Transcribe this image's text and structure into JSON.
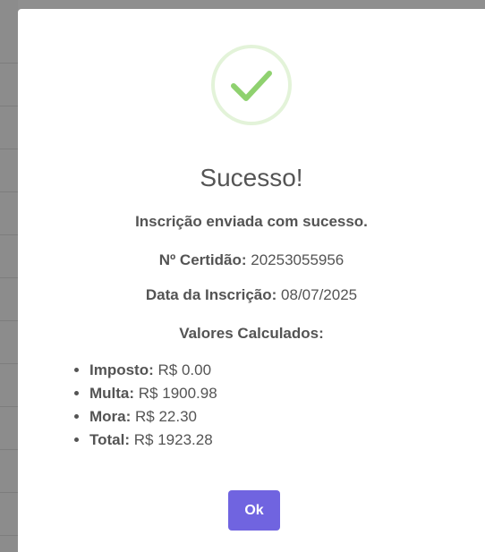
{
  "modal": {
    "title": "Sucesso!",
    "message": "Inscrição enviada com sucesso.",
    "certidao": {
      "label": "Nº Certidão:",
      "value": "20253055956"
    },
    "data_inscricao": {
      "label": "Data da Inscrição:",
      "value": "08/07/2025"
    },
    "valores_heading": "Valores Calculados:",
    "valores": [
      {
        "label": "Imposto:",
        "value": "R$ 0.00"
      },
      {
        "label": "Multa:",
        "value": "R$ 1900.98"
      },
      {
        "label": "Mora:",
        "value": "R$ 22.30"
      },
      {
        "label": "Total:",
        "value": "R$ 1923.28"
      }
    ],
    "ok_label": "Ok",
    "icon": "success-check-icon"
  },
  "colors": {
    "accent": "#7064e0",
    "success": "#8fd16f",
    "success_ring": "#e3f3d9",
    "text": "#545454",
    "overlay": "#8f8f8f"
  }
}
